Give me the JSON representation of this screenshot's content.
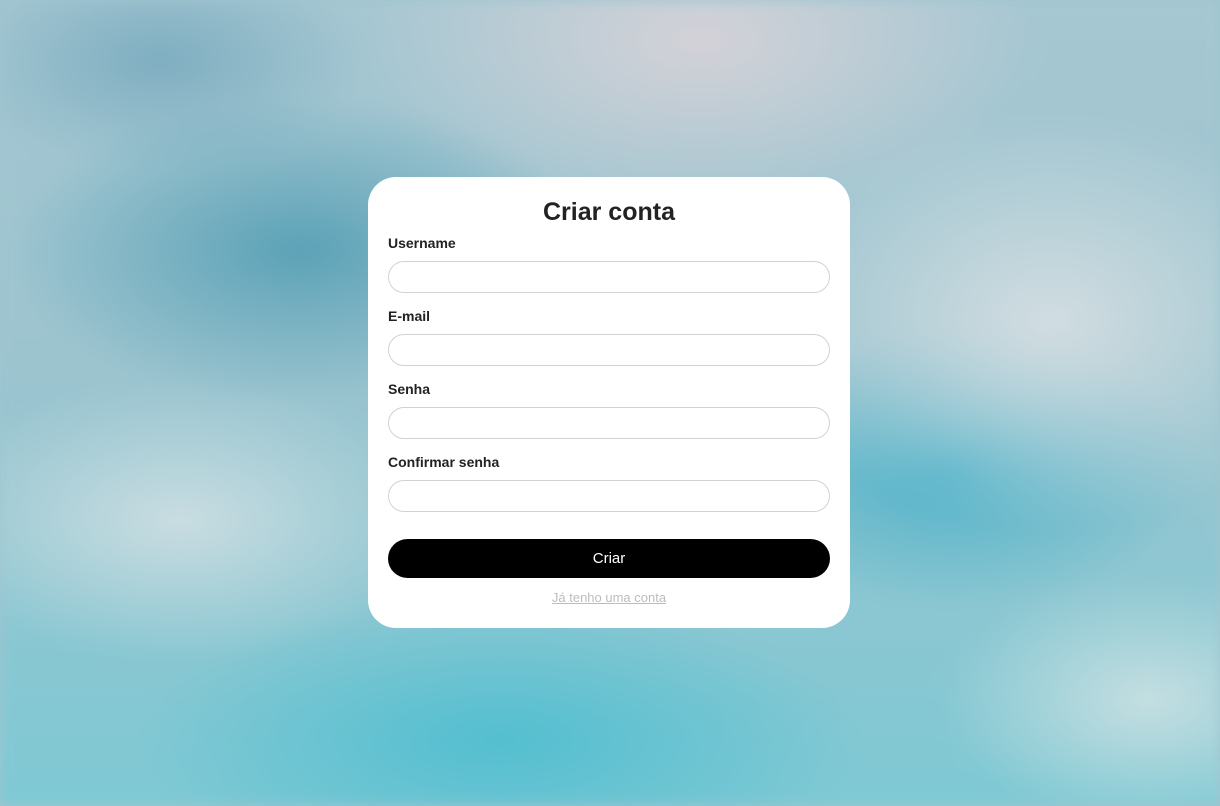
{
  "form": {
    "title": "Criar conta",
    "fields": [
      {
        "label": "Username",
        "value": "",
        "placeholder": ""
      },
      {
        "label": "E-mail",
        "value": "",
        "placeholder": ""
      },
      {
        "label": "Senha",
        "value": "",
        "placeholder": ""
      },
      {
        "label": "Confirmar senha",
        "value": "",
        "placeholder": ""
      }
    ],
    "submit_label": "Criar",
    "login_link": "Já tenho uma conta"
  },
  "colors": {
    "card_background": "#ffffff",
    "button_background": "#000000",
    "button_text": "#ffffff",
    "link_text": "#b9bdc0"
  }
}
